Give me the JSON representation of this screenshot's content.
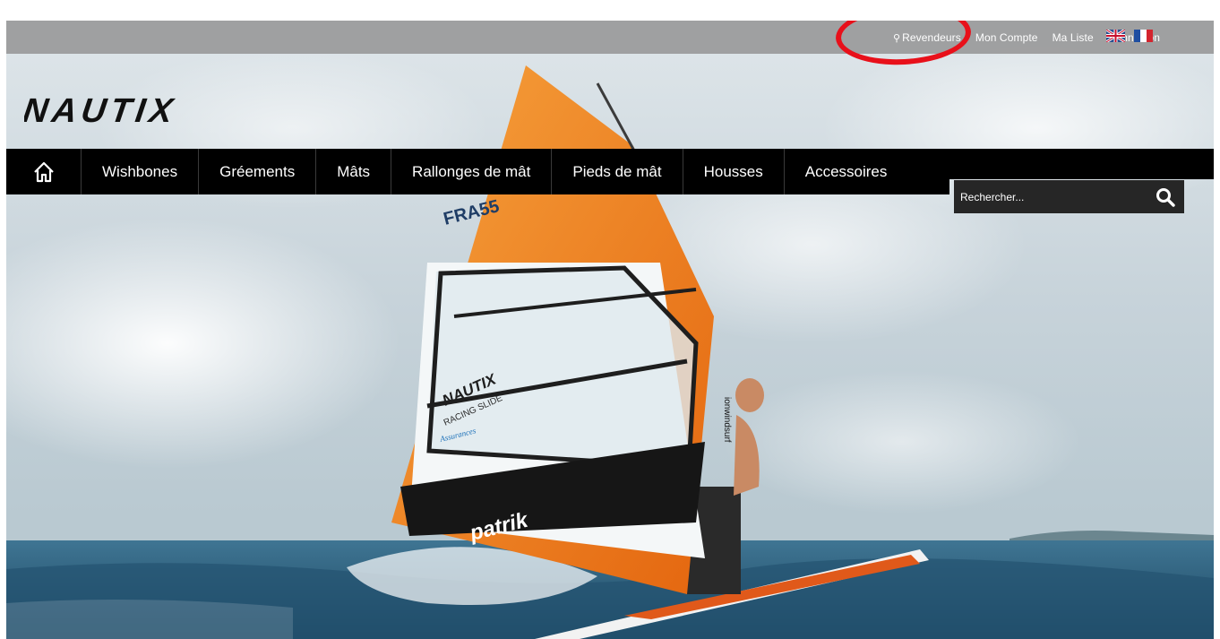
{
  "topbar": {
    "links": [
      {
        "label": "Revendeurs",
        "icon": "map-pin-icon"
      },
      {
        "label": "Mon Compte"
      },
      {
        "label": "Ma Liste"
      },
      {
        "label": "Connexion"
      }
    ],
    "languages": [
      {
        "code": "en",
        "icon": "uk-flag-icon"
      },
      {
        "code": "fr",
        "icon": "france-flag-icon"
      }
    ],
    "background": "#969696"
  },
  "annotation": {
    "color": "#e8101a",
    "target": "Mon Compte"
  },
  "brand": {
    "name": "NAUTIX"
  },
  "nav": {
    "home_icon": "home-icon",
    "items": [
      "Wishbones",
      "Gréements",
      "Mâts",
      "Rallonges de mât",
      "Pieds de mât",
      "Housses",
      "Accessoires"
    ]
  },
  "search": {
    "placeholder": "Rechercher...",
    "icon": "search-icon"
  },
  "hero": {
    "sail_texts": [
      "FRA55",
      "NAUTIX",
      "RACING SLIDE",
      "Assurances",
      "patrik",
      "ionwindsurf"
    ],
    "colors": {
      "sky": "#c9d6dc",
      "sea": "#2c5c78",
      "sail_orange": "#f07a1c"
    }
  }
}
